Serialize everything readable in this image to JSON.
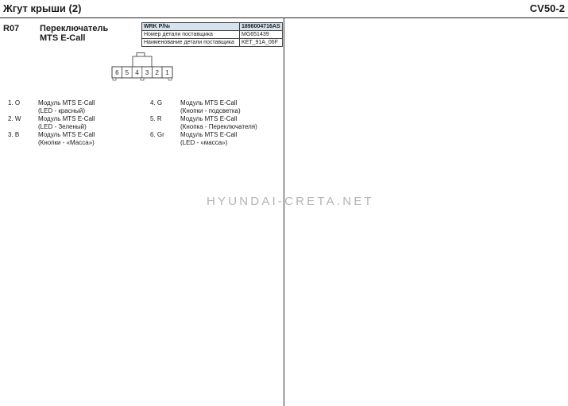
{
  "header": {
    "title": "Жгут крыши (2)",
    "code": "CV50-2"
  },
  "connector": {
    "id": "R07",
    "name_line1": "Переключатель",
    "name_line2": "MTS E-Call",
    "info_table": [
      {
        "key": "WRK P/№",
        "value": "1898004716AS"
      },
      {
        "key": "Номер детали поставщика",
        "value": "MG651439"
      },
      {
        "key": "Наименование детали поставщика",
        "value": "KET_91A_06F"
      }
    ],
    "pin_numbers": [
      "6",
      "5",
      "4",
      "3",
      "2",
      "1"
    ]
  },
  "pins": [
    {
      "num": "1. O",
      "line1": "Модуль MTS E-Call",
      "line2": "(LED - красный)"
    },
    {
      "num": "2. W",
      "line1": "Модуль MTS E-Call",
      "line2": "(LED - Зеленый)"
    },
    {
      "num": "3. B",
      "line1": "Модуль MTS E-Call",
      "line2": "(Кнопки - «Масса»)"
    },
    {
      "num": "4. G",
      "line1": "Модуль MTS E-Call",
      "line2": "(Кнопки - подсветка)"
    },
    {
      "num": "5. R",
      "line1": "Модуль MTS E-Call",
      "line2": "(Кнопка - Переключателя)"
    },
    {
      "num": "6. Gr",
      "line1": "Модуль MTS E-Call",
      "line2": "(LED - «масса»)"
    }
  ],
  "watermark": "HYUNDAI-CRETA.NET"
}
